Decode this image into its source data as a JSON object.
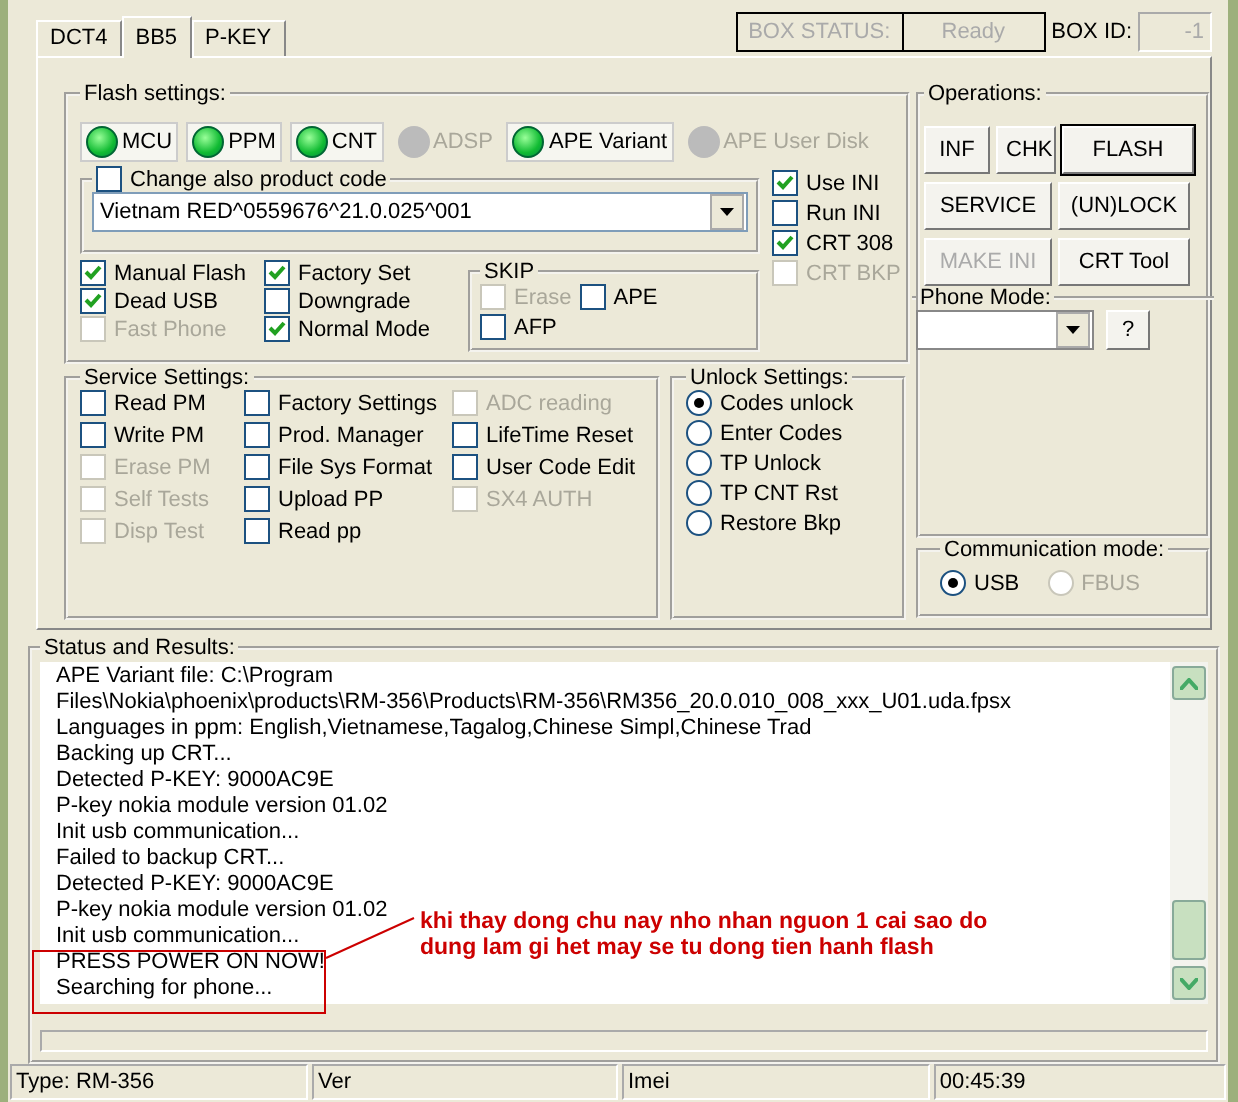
{
  "tabs": [
    {
      "label": "DCT4",
      "selected": false
    },
    {
      "label": "BB5",
      "selected": true
    },
    {
      "label": "P-KEY",
      "selected": false
    }
  ],
  "box_status": {
    "label": "BOX STATUS:",
    "value": "Ready",
    "id_label": "BOX ID:",
    "id_value": "-1"
  },
  "flash_settings": {
    "title": "Flash settings:",
    "indicators": [
      {
        "label": "MCU",
        "on": true
      },
      {
        "label": "PPM",
        "on": true
      },
      {
        "label": "CNT",
        "on": true
      },
      {
        "label": "ADSP",
        "on": false
      },
      {
        "label": "APE Variant",
        "on": true
      },
      {
        "label": "APE User Disk",
        "on": false
      }
    ],
    "product_code": {
      "label": "Change also product code",
      "checked": false,
      "value": "Vietnam RED^0559676^21.0.025^001"
    },
    "ini_options": [
      {
        "label": "Use INI",
        "checked": true,
        "disabled": false
      },
      {
        "label": "Run INI",
        "checked": false,
        "disabled": false
      },
      {
        "label": "CRT 308",
        "checked": true,
        "disabled": false
      },
      {
        "label": "CRT BKP",
        "checked": false,
        "disabled": true
      }
    ],
    "option_columns": [
      [
        {
          "label": "Manual Flash",
          "checked": true,
          "disabled": false
        },
        {
          "label": "Dead USB",
          "checked": true,
          "disabled": false
        },
        {
          "label": "Fast Phone",
          "checked": false,
          "disabled": true
        }
      ],
      [
        {
          "label": "Factory Set",
          "checked": true,
          "disabled": false
        },
        {
          "label": "Downgrade",
          "checked": false,
          "disabled": false
        },
        {
          "label": "Normal Mode",
          "checked": true,
          "disabled": false
        }
      ]
    ],
    "skip": {
      "title": "SKIP",
      "items": [
        {
          "label": "Erase",
          "checked": false,
          "disabled": true
        },
        {
          "label": "APE",
          "checked": false,
          "disabled": false
        },
        {
          "label": "AFP",
          "checked": false,
          "disabled": false
        }
      ]
    }
  },
  "service_settings": {
    "title": "Service Settings:",
    "columns": [
      [
        {
          "label": "Read PM",
          "checked": false,
          "disabled": false
        },
        {
          "label": "Write PM",
          "checked": false,
          "disabled": false
        },
        {
          "label": "Erase PM",
          "checked": false,
          "disabled": true
        },
        {
          "label": "Self Tests",
          "checked": false,
          "disabled": true
        },
        {
          "label": "Disp Test",
          "checked": false,
          "disabled": true
        }
      ],
      [
        {
          "label": "Factory Settings",
          "checked": false,
          "disabled": false
        },
        {
          "label": "Prod. Manager",
          "checked": false,
          "disabled": false
        },
        {
          "label": "File Sys Format",
          "checked": false,
          "disabled": false
        },
        {
          "label": "Upload PP",
          "checked": false,
          "disabled": false
        },
        {
          "label": "Read pp",
          "checked": false,
          "disabled": false
        }
      ],
      [
        {
          "label": "ADC reading",
          "checked": false,
          "disabled": true
        },
        {
          "label": "LifeTime Reset",
          "checked": false,
          "disabled": false
        },
        {
          "label": "User Code Edit",
          "checked": false,
          "disabled": false
        },
        {
          "label": "SX4 AUTH",
          "checked": false,
          "disabled": true
        }
      ]
    ]
  },
  "unlock_settings": {
    "title": "Unlock Settings:",
    "options": [
      {
        "label": "Codes unlock",
        "selected": true
      },
      {
        "label": "Enter Codes",
        "selected": false
      },
      {
        "label": "TP Unlock",
        "selected": false
      },
      {
        "label": "TP CNT Rst",
        "selected": false
      },
      {
        "label": "Restore Bkp",
        "selected": false
      }
    ]
  },
  "operations": {
    "title": "Operations:",
    "buttons": [
      {
        "label": "INF",
        "disabled": false,
        "default": false
      },
      {
        "label": "CHK",
        "disabled": false,
        "default": false
      },
      {
        "label": "FLASH",
        "disabled": false,
        "default": true
      },
      {
        "label": "SERVICE",
        "disabled": false,
        "default": false
      },
      {
        "label": "(UN)LOCK",
        "disabled": false,
        "default": false
      },
      {
        "label": "MAKE INI",
        "disabled": true,
        "default": false
      },
      {
        "label": "CRT Tool",
        "disabled": false,
        "default": false
      }
    ]
  },
  "phone_mode": {
    "title": "Phone Mode:",
    "help": "?"
  },
  "communication_mode": {
    "title": "Communication mode:",
    "options": [
      {
        "label": "USB",
        "selected": true,
        "disabled": false
      },
      {
        "label": "FBUS",
        "selected": false,
        "disabled": true
      }
    ]
  },
  "status_results": {
    "title": "Status and Results:",
    "progress": {
      "level": 0
    },
    "log": [
      "APE Variant file: C:\\Program",
      "Files\\Nokia\\phoenix\\products\\RM-356\\Products\\RM-356\\RM356_20.0.010_008_xxx_U01.uda.fpsx",
      "Languages in ppm: English,Vietnamese,Tagalog,Chinese Simpl,Chinese Trad",
      "Backing up CRT...",
      "Detected P-KEY: 9000AC9E",
      "P-key nokia module version 01.02",
      "Init usb communication...",
      "Failed to backup CRT...",
      "Detected P-KEY: 9000AC9E",
      "P-key nokia module version 01.02",
      "Init usb communication...",
      "PRESS POWER ON NOW!",
      "Searching for phone..."
    ],
    "annotation": "khi thay dong chu nay nho nhan nguon 1 cai sao do dung lam gi het may se tu dong tien hanh flash"
  },
  "status_bar": [
    "Type: RM-356",
    "Ver",
    "Imei",
    "00:45:39"
  ]
}
